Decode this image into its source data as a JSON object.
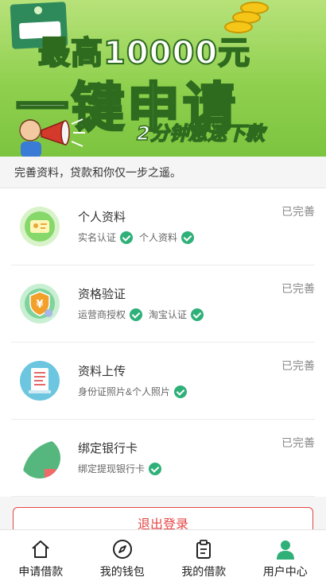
{
  "banner": {
    "line1": "最高10000元",
    "line2": "一键申请",
    "line3": "2分钟急速下款"
  },
  "intro": "完善资料，贷款和你仅一步之遥。",
  "items": [
    {
      "title": "个人资料",
      "status": "已完善",
      "subs": [
        "实名认证",
        "个人资料"
      ],
      "icon": "id-card-icon"
    },
    {
      "title": "资格验证",
      "status": "已完善",
      "subs": [
        "运营商授权",
        "淘宝认证"
      ],
      "icon": "shield-yuan-icon"
    },
    {
      "title": "资料上传",
      "status": "已完善",
      "subs": [
        "身份证照片&个人照片"
      ],
      "icon": "document-upload-icon"
    },
    {
      "title": "绑定银行卡",
      "status": "已完善",
      "subs": [
        "绑定提现银行卡"
      ],
      "icon": "bank-card-icon"
    }
  ],
  "logout_label": "退出登录",
  "tabs": [
    {
      "label": "申请借款",
      "icon": "home-icon"
    },
    {
      "label": "我的钱包",
      "icon": "compass-icon"
    },
    {
      "label": "我的借款",
      "icon": "clipboard-icon"
    },
    {
      "label": "用户中心",
      "icon": "user-icon"
    }
  ],
  "colors": {
    "accent": "#2fb079",
    "danger": "#e64545",
    "banner": "#8fd04e"
  }
}
